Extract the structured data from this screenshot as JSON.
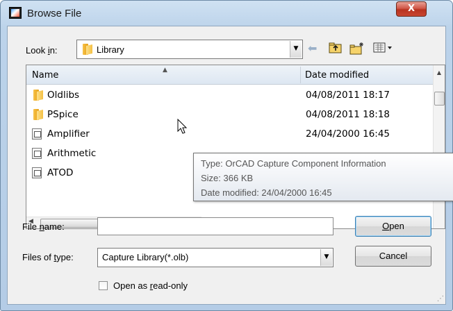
{
  "window": {
    "title": "Browse File",
    "close_glyph": "X"
  },
  "look_in": {
    "label_pre": "Look ",
    "label_accel": "i",
    "label_post": "n:",
    "value": "Library",
    "icon": "folder-icon"
  },
  "toolbar": {
    "back_icon": "back-arrow-icon",
    "up_icon": "up-folder-icon",
    "new_folder_icon": "new-folder-icon",
    "view_menu_icon": "view-menu-icon"
  },
  "file_list": {
    "columns": {
      "name": "Name",
      "date": "Date modified"
    },
    "rows": [
      {
        "name": "Oldlibs",
        "date": "04/08/2011 18:17",
        "icon": "folder-icon"
      },
      {
        "name": "PSpice",
        "date": "04/08/2011 18:18",
        "icon": "folder-icon"
      },
      {
        "name": "Amplifier",
        "date": "24/04/2000 16:45",
        "icon": "library-file-icon"
      },
      {
        "name": "Arithmetic",
        "date": "",
        "icon": "library-file-icon"
      },
      {
        "name": "ATOD",
        "date": "",
        "icon": "library-file-icon"
      }
    ],
    "hscroll_grip": "III"
  },
  "tooltip": {
    "type": "Type: OrCAD Capture Component Information",
    "size": "Size: 366 KB",
    "date": "Date modified: 24/04/2000 16:45"
  },
  "file_name": {
    "label_pre": "File ",
    "label_accel": "n",
    "label_post": "ame:",
    "value": ""
  },
  "file_type": {
    "label_pre": "Files of ",
    "label_accel": "t",
    "label_post": "ype:",
    "value": "Capture Library(*.olb)"
  },
  "buttons": {
    "open_accel": "O",
    "open_rest": "pen",
    "cancel": "Cancel"
  },
  "read_only": {
    "label_pre": "Open as ",
    "label_accel": "r",
    "label_post": "ead-only",
    "checked": false
  }
}
